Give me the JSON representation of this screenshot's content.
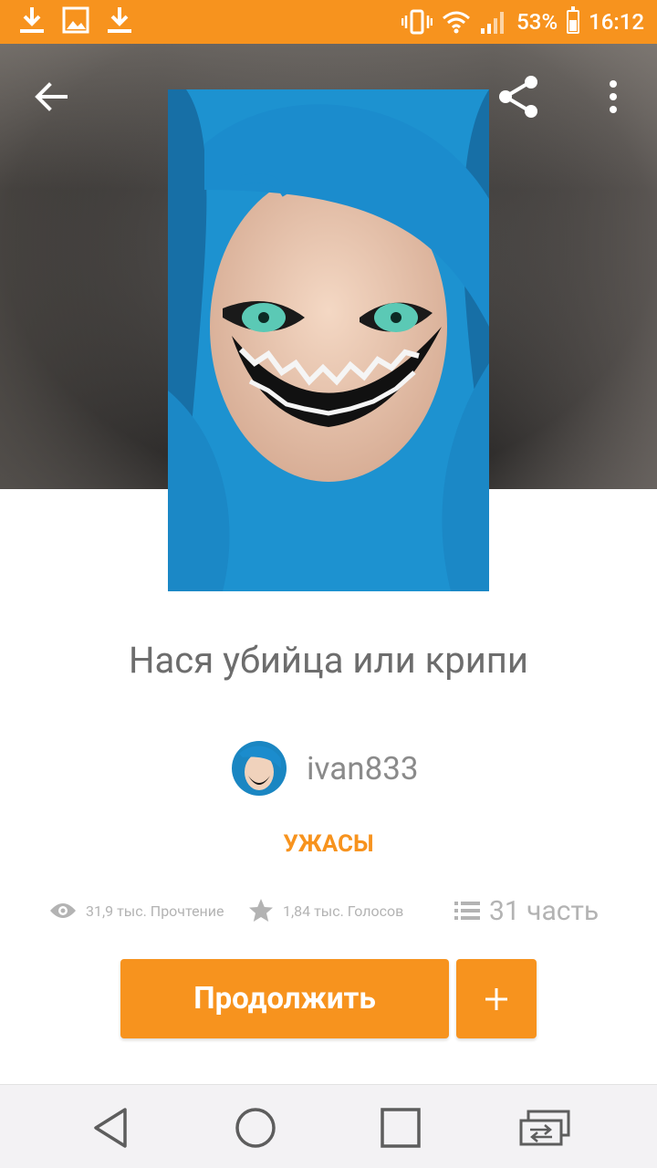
{
  "status_bar": {
    "battery_percent": "53%",
    "time": "16:12",
    "left_icons": [
      "download-icon",
      "image-icon",
      "download-icon"
    ],
    "right_icons": [
      "vibrate-icon",
      "wifi-icon",
      "signal-icon",
      "battery-icon"
    ]
  },
  "header": {
    "icons": [
      "back-arrow-icon",
      "share-icon",
      "more-vert-icon"
    ]
  },
  "story": {
    "title": "Нася убийца или крипи",
    "author": "ivan833",
    "genre": "УЖАСЫ",
    "reads": "31,9 тыс. Прочтение",
    "votes": "1,84 тыс. Голосов",
    "parts": "31 часть"
  },
  "actions": {
    "continue_label": "Продолжить",
    "add_label": "+"
  },
  "colors": {
    "accent": "#f7931e",
    "title_text": "#6d6d6d",
    "stat_text": "#b3b3b3",
    "nav_bar": "#f3f2f4"
  },
  "nav_bar": {
    "icons": [
      "nav-back-icon",
      "nav-home-icon",
      "nav-recents-icon",
      "nav-switch-icon"
    ]
  }
}
